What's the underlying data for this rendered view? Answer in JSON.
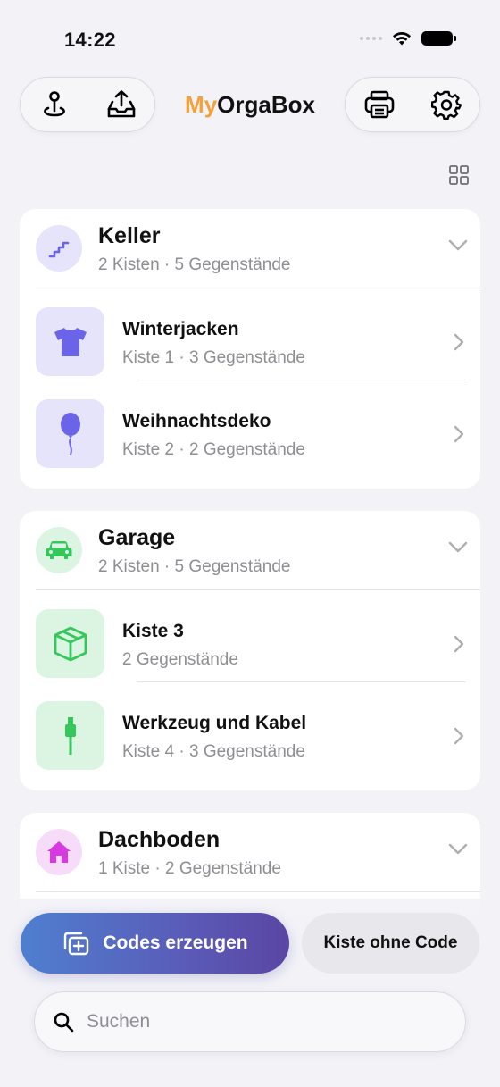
{
  "status_bar": {
    "time": "14:22"
  },
  "header": {
    "title_accent": "My",
    "title_rest": "OrgaBox",
    "accent_color": "#f5a03a"
  },
  "locations": [
    {
      "name": "Keller",
      "summary": "2 Kisten · 5 Gegenstände",
      "icon": "stairs-icon",
      "color": "#6b63e8",
      "bg": "#e6e4fb",
      "boxes": [
        {
          "name": "Winterjacken",
          "summary": "Kiste 1 · 3 Gegenstände",
          "icon": "tshirt-icon"
        },
        {
          "name": "Weihnachtsdeko",
          "summary": "Kiste 2 · 2 Gegenstände",
          "icon": "balloon-icon"
        }
      ]
    },
    {
      "name": "Garage",
      "summary": "2 Kisten · 5 Gegenstände",
      "icon": "car-icon",
      "color": "#34c759",
      "bg": "#dcf5e3",
      "boxes": [
        {
          "name": "Kiste 3",
          "summary": "2 Gegenstände",
          "icon": "box-icon"
        },
        {
          "name": "Werkzeug und Kabel",
          "summary": "Kiste 4 · 3 Gegenstände",
          "icon": "cable-icon"
        }
      ]
    },
    {
      "name": "Dachboden",
      "summary": "1 Kiste · 2 Gegenstände",
      "icon": "house-icon",
      "color": "#d63ae0",
      "bg": "#f6dcf8",
      "boxes": []
    }
  ],
  "actions": {
    "generate_codes": "Codes erzeugen",
    "box_without_code": "Kiste ohne Code"
  },
  "search": {
    "placeholder": "Suchen"
  }
}
